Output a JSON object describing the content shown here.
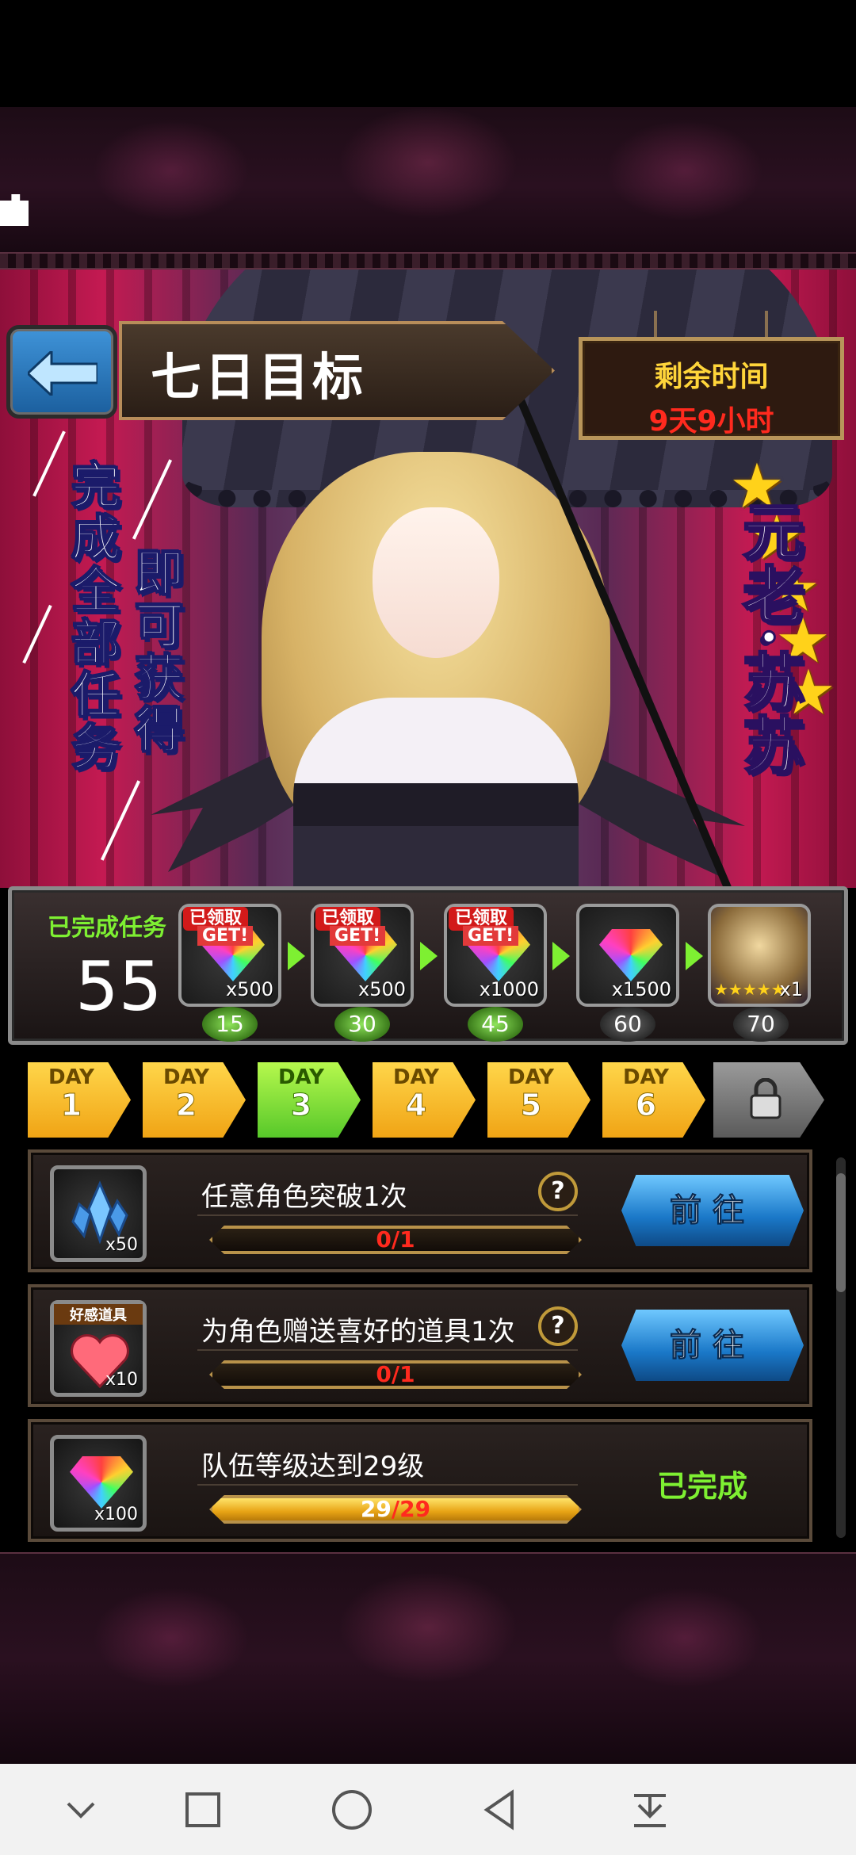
{
  "header": {
    "title": "七日目标",
    "timer_label": "剩余时间",
    "timer_value": "9天9小时"
  },
  "banner": {
    "promo_line1": "完成全部任务",
    "promo_line2": "即可获得",
    "hero_name": "元老·苏苏",
    "hero_stars": 5
  },
  "rewards": {
    "completed_label": "已完成任务",
    "completed_count": "55",
    "claimed_label": "已领取",
    "get_label": "GET!",
    "items": [
      {
        "icon": "rainbow-gem-icon",
        "qty": "x500",
        "milestone": "15",
        "claimed": true
      },
      {
        "icon": "rainbow-gem-icon",
        "qty": "x500",
        "milestone": "30",
        "claimed": true
      },
      {
        "icon": "rainbow-gem-icon",
        "qty": "x1000",
        "milestone": "45",
        "claimed": true
      },
      {
        "icon": "rainbow-gem-icon",
        "qty": "x1500",
        "milestone": "60",
        "claimed": false
      },
      {
        "icon": "hero-portrait-icon",
        "qty": "x1",
        "milestone": "70",
        "claimed": false,
        "stars": "★★★★★"
      }
    ]
  },
  "days": {
    "prefix": "DAY",
    "tabs": [
      "1",
      "2",
      "3",
      "4",
      "5",
      "6"
    ],
    "active": "3",
    "locked_icon": "lock-icon"
  },
  "tasks": [
    {
      "icon": "crystal-shard-icon",
      "qty": "x50",
      "label": "任意角色突破1次",
      "current": "0",
      "total": "1",
      "progress": 0,
      "action": "前往",
      "status": "pending"
    },
    {
      "icon": "heart-gift-icon",
      "icon_tag": "好感道具",
      "qty": "x10",
      "label": "为角色赠送喜好的道具1次",
      "current": "0",
      "total": "1",
      "progress": 0,
      "action": "前往",
      "status": "pending"
    },
    {
      "icon": "rainbow-gem-icon",
      "qty": "x100",
      "label": "队伍等级达到29级",
      "current": "29",
      "total": "29",
      "progress": 1,
      "action": "已完成",
      "status": "done"
    }
  ],
  "colors": {
    "accent_green": "#7ef032",
    "timer_red": "#ff2a1e",
    "gold": "#ffd21a",
    "button_blue": "#1a78c8"
  },
  "nav": {
    "icons": [
      "chevron-down-icon",
      "square-icon",
      "circle-home-icon",
      "triangle-back-icon",
      "download-icon"
    ]
  }
}
